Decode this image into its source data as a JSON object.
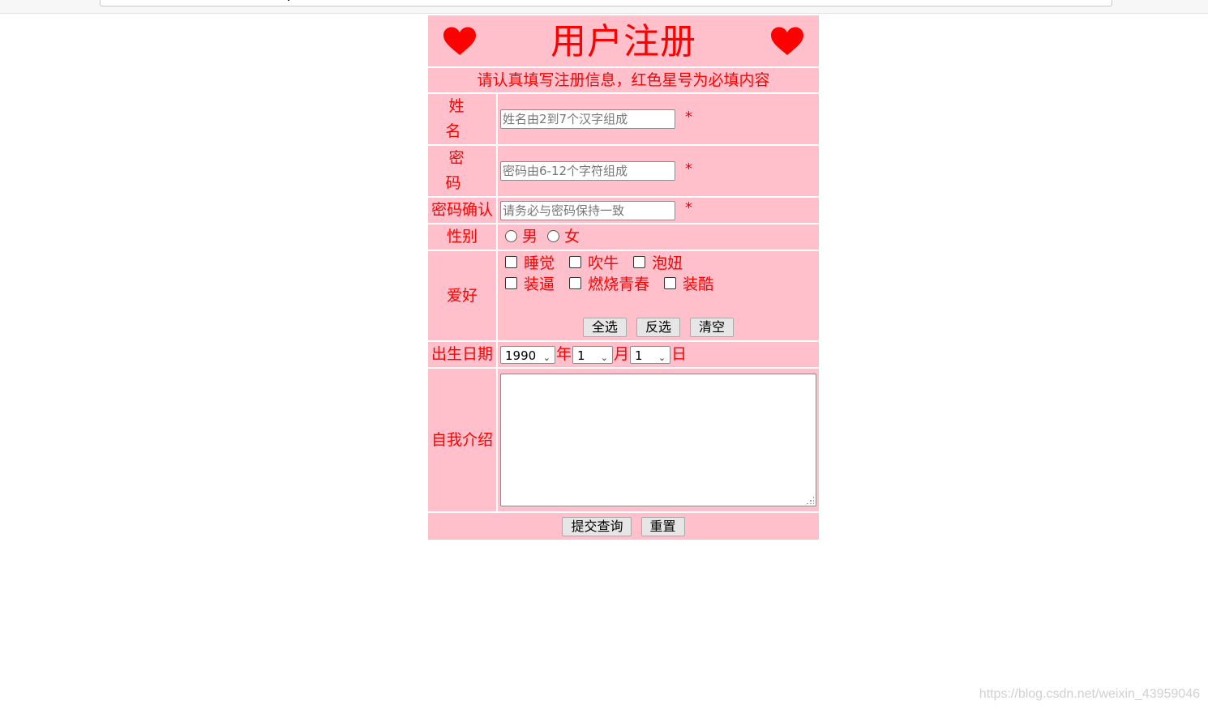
{
  "form": {
    "title": "用户注册",
    "subtitle": "请认真填写注册信息，红色星号为必填内容",
    "required_mark": "*",
    "name": {
      "label": "姓名",
      "placeholder": "姓名由2到7个汉字组成"
    },
    "password": {
      "label": "密码",
      "placeholder": "密码由6-12个字符组成"
    },
    "confirm": {
      "label": "密码确认",
      "placeholder": "请务必与密码保持一致"
    },
    "gender": {
      "label": "性别",
      "options": [
        "男",
        "女"
      ]
    },
    "hobby": {
      "label": "爱好",
      "options": [
        "睡觉",
        "吹牛",
        "泡妞",
        "装逼",
        "燃烧青春",
        "装酷"
      ],
      "buttons": {
        "select_all": "全选",
        "invert": "反选",
        "clear": "清空"
      }
    },
    "birth": {
      "label": "出生日期",
      "year": "1990",
      "year_unit": "年",
      "month": "1",
      "month_unit": "月",
      "day": "1",
      "day_unit": "日"
    },
    "intro": {
      "label": "自我介绍"
    },
    "actions": {
      "submit": "提交查询",
      "reset": "重置"
    }
  },
  "colors": {
    "background": "#ffc0cb",
    "text": "#ff0000",
    "heart": "#ff0000"
  },
  "watermark": "https://blog.csdn.net/weixin_43959046"
}
